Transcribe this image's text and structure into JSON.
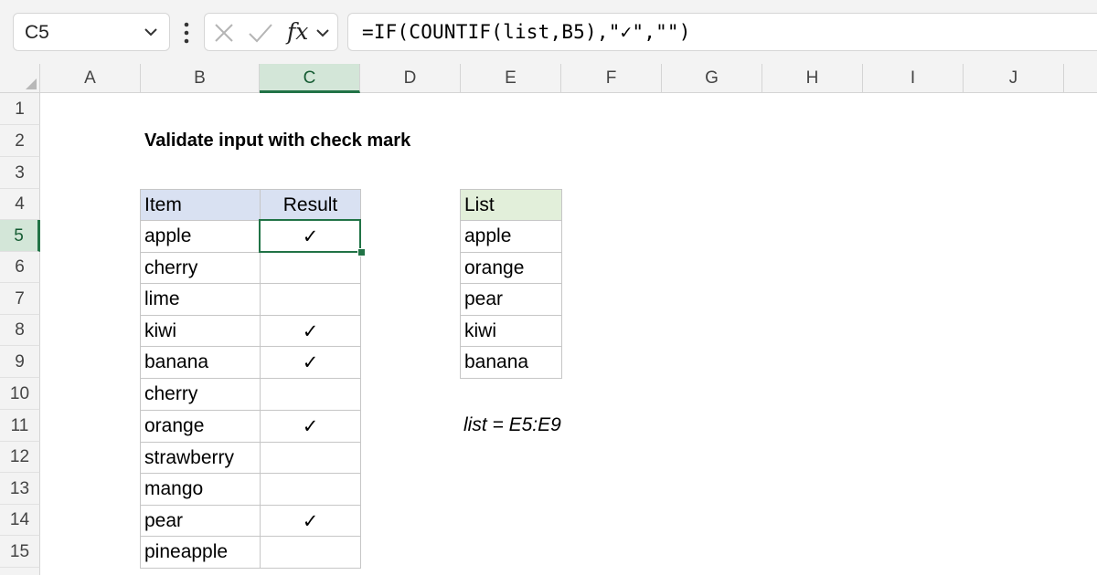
{
  "name_box": {
    "value": "C5"
  },
  "formula_bar": {
    "fx_label": "fx",
    "formula": "=IF(COUNTIF(list,B5),\"✓\",\"\")"
  },
  "columns": [
    "A",
    "B",
    "C",
    "D",
    "E",
    "F",
    "G",
    "H",
    "I",
    "J"
  ],
  "active_column": "C",
  "rows": [
    "1",
    "2",
    "3",
    "4",
    "5",
    "6",
    "7",
    "8",
    "9",
    "10",
    "11",
    "12",
    "13",
    "14",
    "15"
  ],
  "active_row": "5",
  "sheet": {
    "title": "Validate input with check mark",
    "item_header": "Item",
    "result_header": "Result",
    "items": [
      {
        "item": "apple",
        "result": "✓"
      },
      {
        "item": "cherry",
        "result": ""
      },
      {
        "item": "lime",
        "result": ""
      },
      {
        "item": "kiwi",
        "result": "✓"
      },
      {
        "item": "banana",
        "result": "✓"
      },
      {
        "item": "cherry",
        "result": ""
      },
      {
        "item": "orange",
        "result": "✓"
      },
      {
        "item": "strawberry",
        "result": ""
      },
      {
        "item": "mango",
        "result": ""
      },
      {
        "item": "pear",
        "result": "✓"
      },
      {
        "item": "pineapple",
        "result": ""
      }
    ],
    "list_header": "List",
    "list": [
      "apple",
      "orange",
      "pear",
      "kiwi",
      "banana"
    ],
    "note": "list = E5:E9"
  },
  "colors": {
    "accent": "#217346",
    "item_header_fill": "#d9e1f2",
    "list_header_fill": "#e2efda"
  }
}
